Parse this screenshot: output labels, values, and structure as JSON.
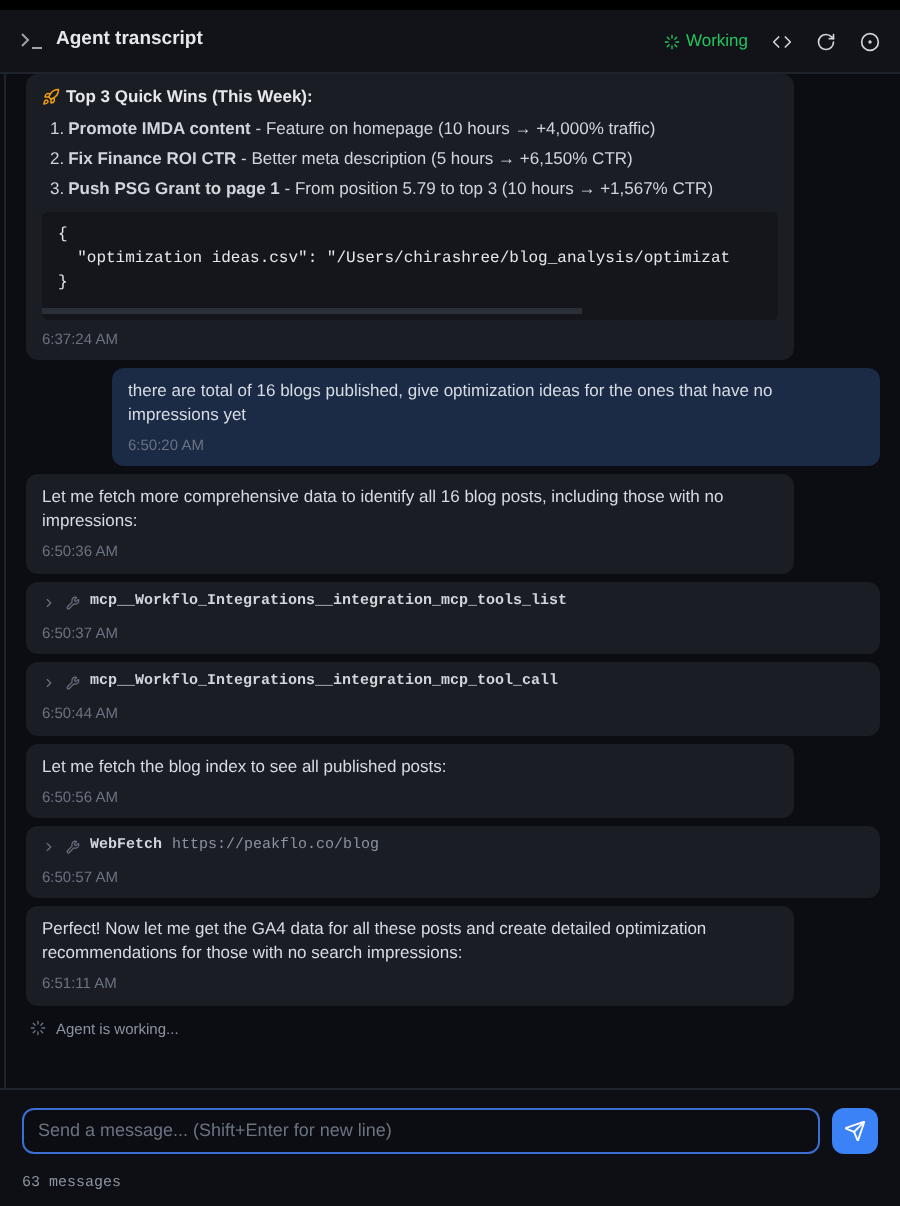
{
  "header": {
    "title": "Agent transcript",
    "status": "Working"
  },
  "messages": [
    {
      "kind": "assistant",
      "heading": "Top 3 Quick Wins (This Week):",
      "items": [
        {
          "number": "1.",
          "text": "**Promote IMDA content** - Feature on homepage (10 hours → +4,000% traffic)"
        },
        {
          "number": "2.",
          "text": "**Fix Finance ROI CTR** - Better meta description (5 hours → +6,150% CTR)"
        },
        {
          "number": "3.",
          "text": "**Push PSG Grant to page 1** - From position 5.79 to top 3 (10 hours → +1,567% CTR)"
        }
      ],
      "code": [
        "{",
        "  \"optimization ideas.csv\": \"/Users/chirashree/blog_analysis/optimizat",
        "}"
      ],
      "time": "6:37:24 AM"
    },
    {
      "kind": "user",
      "text": "there are total of 16 blogs published, give optimization ideas for the ones that have no impressions yet",
      "time": "6:50:20 AM"
    },
    {
      "kind": "assistant",
      "text": "Let me fetch more comprehensive data to identify all 16 blog posts, including those with no impressions:",
      "time": "6:50:36 AM"
    },
    {
      "kind": "tool",
      "name": "mcp__Workflo_Integrations__integration_mcp_tools_list",
      "time": "6:50:37 AM"
    },
    {
      "kind": "tool",
      "name": "mcp__Workflo_Integrations__integration_mcp_tool_call",
      "time": "6:50:44 AM"
    },
    {
      "kind": "assistant",
      "text": "Let me fetch the blog index to see all published posts:",
      "time": "6:50:56 AM"
    },
    {
      "kind": "tool",
      "name": "WebFetch",
      "arg": "https://peakflo.co/blog",
      "time": "6:50:57 AM"
    },
    {
      "kind": "assistant",
      "text": "Perfect! Now let me get the GA4 data for all these posts and create detailed optimization recommendations for those with no search impressions:",
      "time": "6:51:11 AM"
    }
  ],
  "working": "Agent is working...",
  "input": {
    "placeholder": "Send a message... (Shift+Enter for new line)"
  },
  "footer": "63 messages"
}
